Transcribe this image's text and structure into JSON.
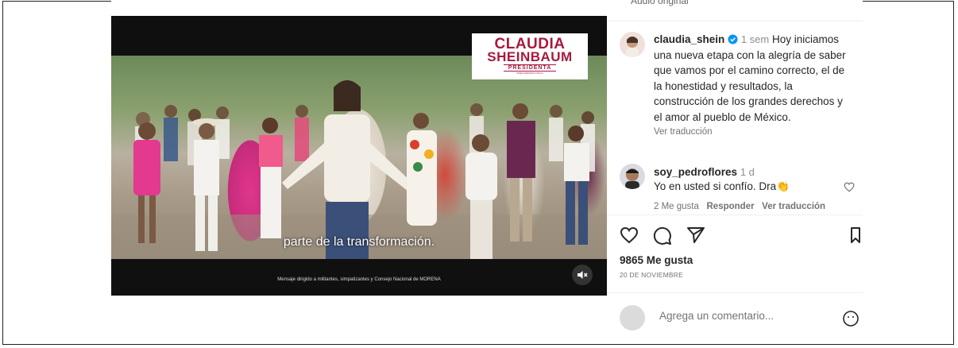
{
  "video": {
    "logo_line1": "CLAUDIA",
    "logo_line2": "SHEINBAUM",
    "logo_line3": "PRESIDENTA",
    "logo_line4": "PRECANDIDATA UNICA",
    "subtitle": "parte de la transformación.",
    "disclaimer": "Mensaje dirigido a militantes, simpatizantes y Consejo Nacional de MORENA",
    "mute_icon": "speaker-muted-icon"
  },
  "sidebar": {
    "audio_label": "Audio original",
    "caption": {
      "username": "claudia_shein",
      "time": "1 sem",
      "text": "Hoy iniciamos una nueva etapa con la alegría de saber que vamos por el camino correcto, el de la honestidad y resultados, la construcción de los grandes derechos y el amor al pueblo de México.",
      "translate": "Ver traducción"
    },
    "comment": {
      "username": "soy_pedroflores",
      "time": "1 d",
      "text": "Yo en usted si confío. Dra",
      "emoji": "👏",
      "likes": "2 Me gusta",
      "reply": "Responder",
      "translate": "Ver traducción"
    },
    "actions": {
      "like_icon": "heart-icon",
      "comment_icon": "comment-bubble-icon",
      "share_icon": "send-icon",
      "save_icon": "bookmark-icon"
    },
    "likes_count": "9865 Me gusta",
    "date": "20 DE NOVIEMBRE",
    "add_comment_placeholder": "Agrega un comentario...",
    "emoji_icon": "smiley-icon"
  }
}
